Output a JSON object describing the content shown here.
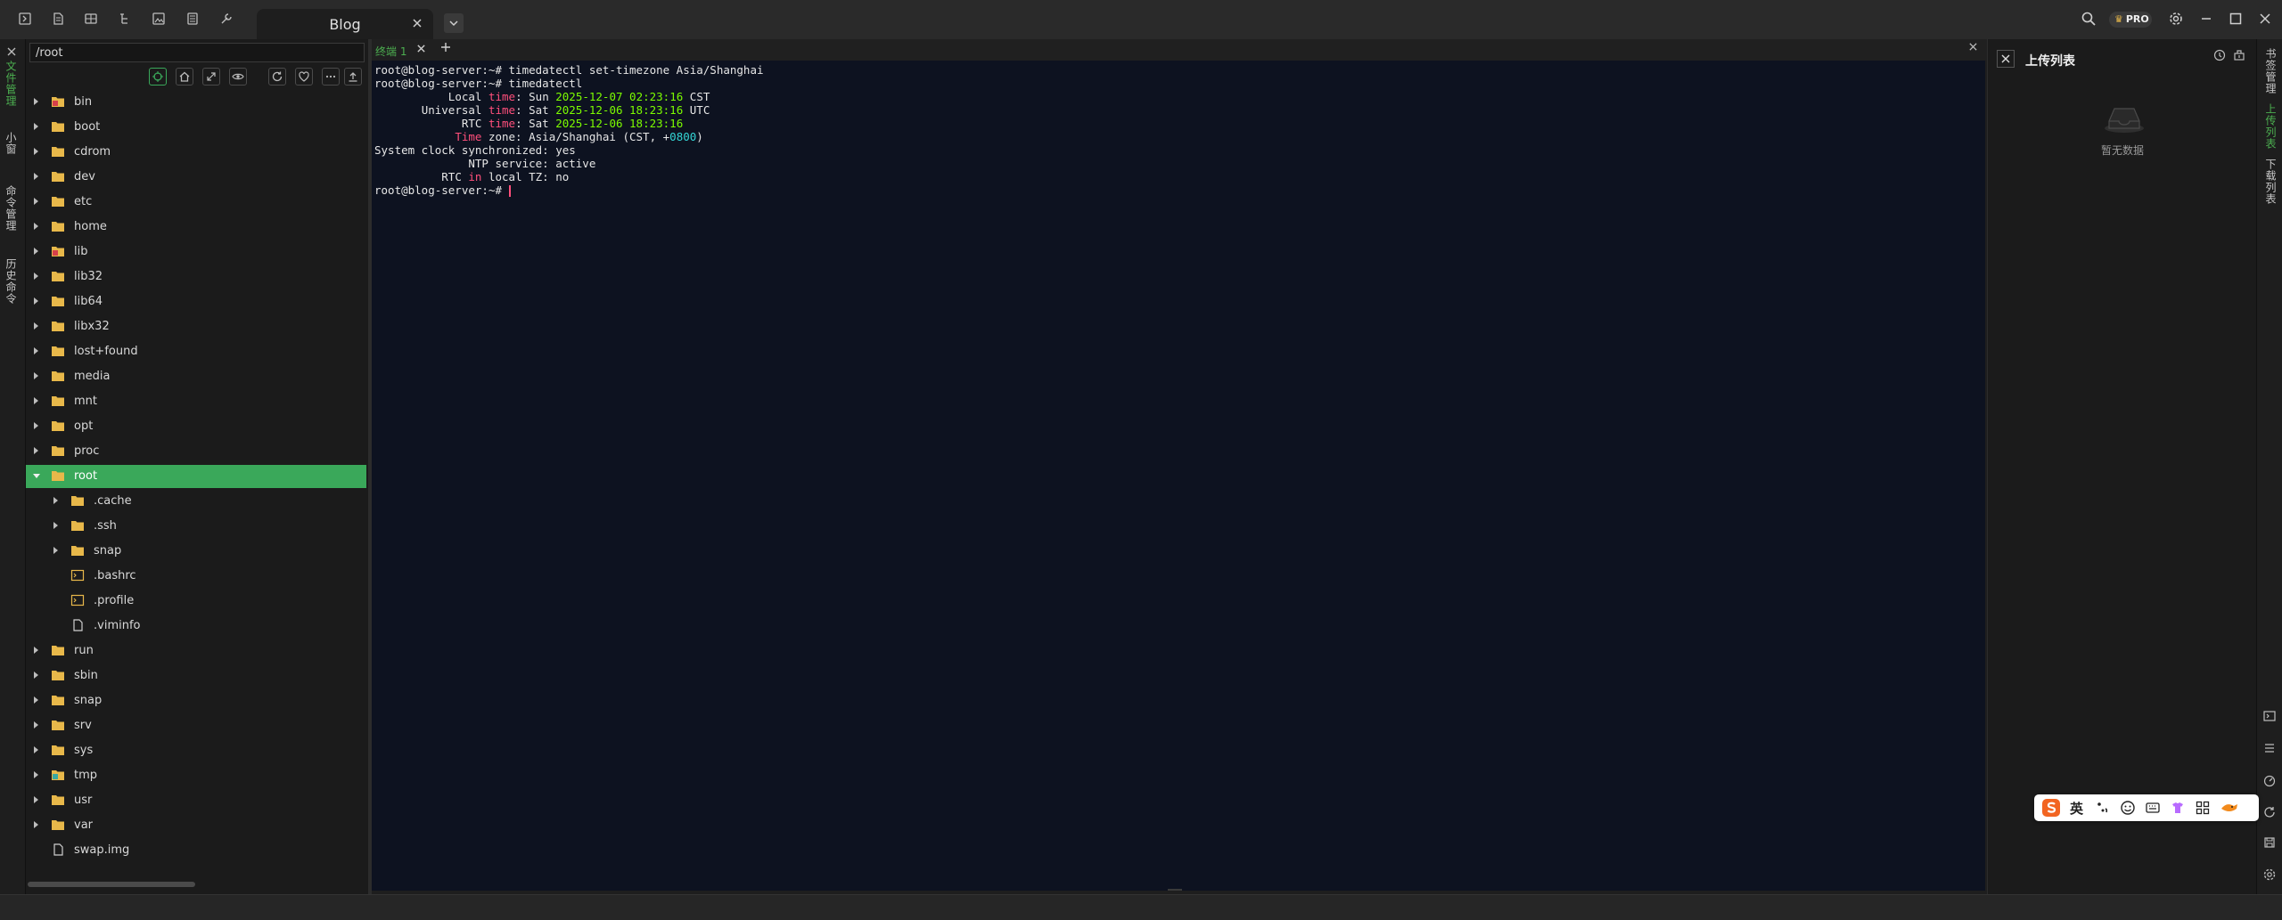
{
  "tabs": {
    "active_label": "Blog"
  },
  "left_tabs": [
    "文件管理",
    "小窗",
    "命令管理",
    "历史命令"
  ],
  "file_panel": {
    "path": "/root",
    "items": [
      {
        "name": "bin",
        "icon": "folder-link-icon"
      },
      {
        "name": "boot",
        "icon": "folder-icon"
      },
      {
        "name": "cdrom",
        "icon": "folder-icon"
      },
      {
        "name": "dev",
        "icon": "folder-icon"
      },
      {
        "name": "etc",
        "icon": "folder-icon"
      },
      {
        "name": "home",
        "icon": "folder-icon"
      },
      {
        "name": "lib",
        "icon": "folder-link-icon"
      },
      {
        "name": "lib32",
        "icon": "folder-icon"
      },
      {
        "name": "lib64",
        "icon": "folder-icon"
      },
      {
        "name": "libx32",
        "icon": "folder-icon"
      },
      {
        "name": "lost+found",
        "icon": "folder-icon"
      },
      {
        "name": "media",
        "icon": "folder-icon"
      },
      {
        "name": "mnt",
        "icon": "folder-icon"
      },
      {
        "name": "opt",
        "icon": "folder-icon"
      },
      {
        "name": "proc",
        "icon": "folder-icon"
      },
      {
        "name": "root",
        "icon": "folder-icon"
      },
      {
        "name": ".cache",
        "icon": "folder-icon"
      },
      {
        "name": ".ssh",
        "icon": "folder-icon"
      },
      {
        "name": "snap",
        "icon": "folder-icon"
      },
      {
        "name": ".bashrc",
        "icon": "shell-file-icon"
      },
      {
        "name": ".profile",
        "icon": "shell-file-icon"
      },
      {
        "name": ".viminfo",
        "icon": "file-icon"
      },
      {
        "name": "run",
        "icon": "folder-icon"
      },
      {
        "name": "sbin",
        "icon": "folder-icon"
      },
      {
        "name": "snap",
        "icon": "folder-icon"
      },
      {
        "name": "srv",
        "icon": "folder-icon"
      },
      {
        "name": "sys",
        "icon": "folder-icon"
      },
      {
        "name": "tmp",
        "icon": "folder-special-icon"
      },
      {
        "name": "usr",
        "icon": "folder-icon"
      },
      {
        "name": "var",
        "icon": "folder-icon"
      },
      {
        "name": "swap.img",
        "icon": "file-icon"
      }
    ]
  },
  "terminal": {
    "tab_label": "终端 1",
    "prompt": "root@blog-server:~#",
    "cmd1": "timedatectl set-timezone Asia/Shanghai",
    "cmd2": "timedatectl",
    "local_label": "Local",
    "time_word": "time",
    "weekday_local": "Sun",
    "date_local": "2025-12-07",
    "clock_local": "02:23:16",
    "tz_local": "CST",
    "universal_label": "Universal",
    "weekday_utc": "Sat",
    "date_utc": "2025-12-06",
    "clock_utc": "18:23:16",
    "tz_utc": "UTC",
    "rtc_label": "RTC",
    "weekday_rtc": "Sat",
    "date_rtc": "2025-12-06",
    "clock_rtc": "18:23:16",
    "time_cap": "Time",
    "zone_label": "zone:",
    "zone_value_pre": "Asia/Shanghai (CST, +",
    "zone_offset": "0800",
    "zone_value_post": ")",
    "sync_label": "System clock synchronized:",
    "sync_value": "yes",
    "ntp_label": "NTP service:",
    "ntp_value": "active",
    "rtc_in_pre": "RTC",
    "rtc_in_word": "in",
    "rtc_in_post": "local TZ:",
    "rtc_in_value": "no"
  },
  "upload_panel": {
    "title": "上传列表",
    "empty_text": "暂无数据"
  },
  "right_tabs": [
    "书签管理",
    "上传列表",
    "下载列表"
  ],
  "pro_badge": "PRO",
  "ime": {
    "lang": "英"
  },
  "colors": {
    "accent": "#3aa85a",
    "terminal_bg": "#0d1220",
    "keyword_red": "#ff4f7b",
    "value_green": "#7cfc00",
    "value_cyan": "#34d5d5",
    "folder_yellow": "#e8b84a"
  }
}
